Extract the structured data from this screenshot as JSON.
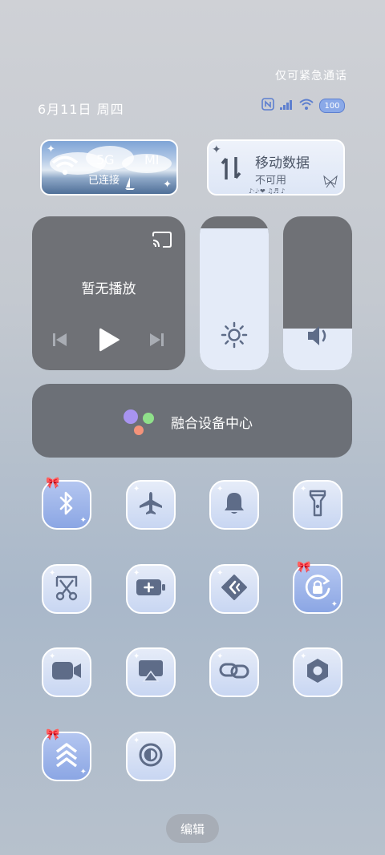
{
  "status": {
    "emergency_text": "仅可紧急通话",
    "date_text": "6月11日 周四",
    "battery_level": "100",
    "icons": [
      "nfc-icon",
      "signal-icon",
      "wifi-icon",
      "battery-icon"
    ]
  },
  "wifi_tile": {
    "band": "5G",
    "network": "MI",
    "status": "已连接",
    "icon": "wifi-icon"
  },
  "data_tile": {
    "title": "移动数据",
    "status": "不可用",
    "decoration": "♪·♩·❤ ♫♬ ♪",
    "icon": "data-arrows-icon"
  },
  "media": {
    "title": "暂无播放",
    "icons": [
      "cast-icon",
      "previous-icon",
      "play-icon",
      "next-icon"
    ]
  },
  "brightness": {
    "level": 0.92,
    "icon": "sun-icon"
  },
  "volume": {
    "level": 0.27,
    "icon": "speaker-icon"
  },
  "fusion": {
    "label": "融合设备中心",
    "icon": "fusion-device-icon"
  },
  "toggles": [
    {
      "name": "bluetooth",
      "icon": "bluetooth-icon",
      "active": true
    },
    {
      "name": "airplane-mode",
      "icon": "airplane-icon",
      "active": false
    },
    {
      "name": "ring-mode",
      "icon": "bell-icon",
      "active": false
    },
    {
      "name": "flashlight",
      "icon": "flashlight-icon",
      "active": false
    },
    {
      "name": "screenshot",
      "icon": "scissors-icon",
      "active": false
    },
    {
      "name": "battery-saver",
      "icon": "battery-plus-icon",
      "active": false
    },
    {
      "name": "screen-cast",
      "icon": "cast-diamond-icon",
      "active": false
    },
    {
      "name": "rotation-lock",
      "icon": "rotation-lock-icon",
      "active": true
    },
    {
      "name": "screen-record",
      "icon": "video-camera-icon",
      "active": false
    },
    {
      "name": "airplay",
      "icon": "airplay-icon",
      "active": false
    },
    {
      "name": "link",
      "icon": "link-icon",
      "active": false
    },
    {
      "name": "settings",
      "icon": "hexagon-settings-icon",
      "active": false
    },
    {
      "name": "performance-mode",
      "icon": "chevrons-up-icon",
      "active": true
    },
    {
      "name": "dark-mode",
      "icon": "contrast-icon",
      "active": false
    }
  ],
  "edit_label": "编辑",
  "colors": {
    "icon": "#5e6c88",
    "active_tile": "#8ba6e4",
    "tile": "#dfe7f7",
    "panel": "#6f7176"
  }
}
